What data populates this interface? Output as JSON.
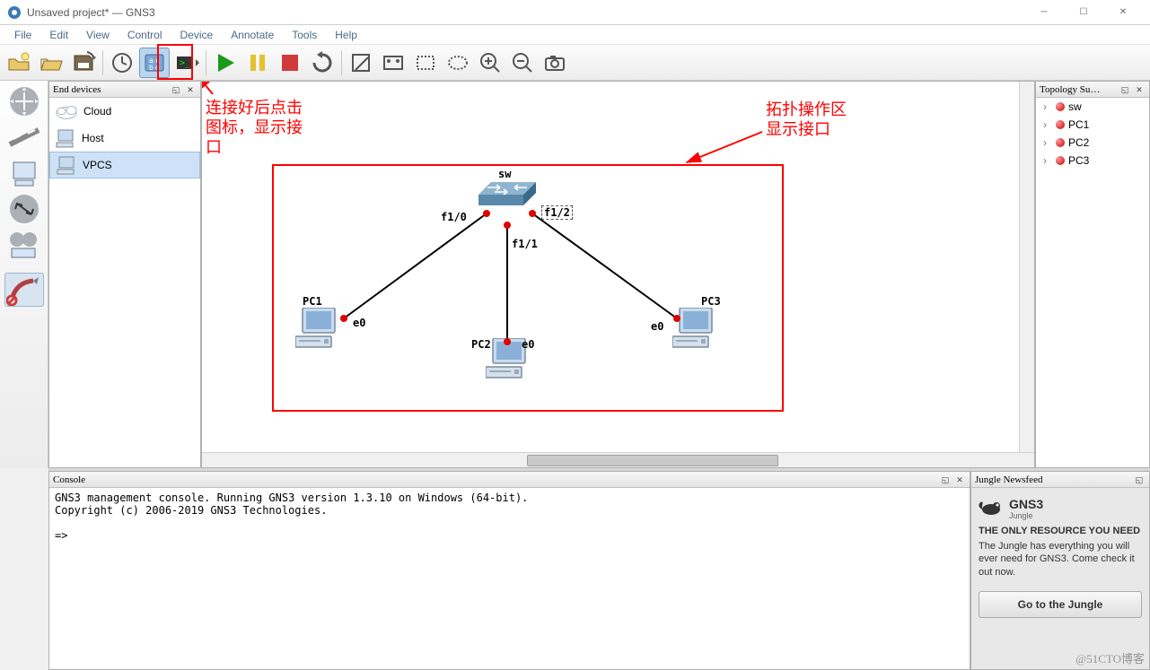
{
  "app": {
    "title": "Unsaved project* — GNS3"
  },
  "menu": [
    "File",
    "Edit",
    "View",
    "Control",
    "Device",
    "Annotate",
    "Tools",
    "Help"
  ],
  "end_devices": {
    "title": "End devices",
    "items": [
      "Cloud",
      "Host",
      "VPCS"
    ],
    "selected": 2
  },
  "topology_summary": {
    "title": "Topology Su…",
    "nodes": [
      "sw",
      "PC1",
      "PC2",
      "PC3"
    ]
  },
  "annotations": {
    "left": "连接好后点击\n图标，显示接\n口",
    "right": "拓扑操作区\n显示接口"
  },
  "topology": {
    "nodes": {
      "sw": {
        "label": "sw",
        "ports": [
          "f1/0",
          "f1/1",
          "f1/2"
        ]
      },
      "pc1": {
        "label": "PC1",
        "port": "e0"
      },
      "pc2": {
        "label": "PC2",
        "port": "e0"
      },
      "pc3": {
        "label": "PC3",
        "port": "e0"
      }
    }
  },
  "console": {
    "title": "Console",
    "lines": "GNS3 management console. Running GNS3 version 1.3.10 on Windows (64-bit).\nCopyright (c) 2006-2019 GNS3 Technologies.\n\n=> "
  },
  "newsfeed": {
    "title": "Jungle Newsfeed",
    "brand": "GNS3",
    "brand_sub": "Jungle",
    "headline": "THE ONLY RESOURCE YOU NEED",
    "body": "The Jungle has everything you will ever need for GNS3. Come check it out now.",
    "button": "Go to the Jungle"
  },
  "watermark": "@51CTO博客"
}
